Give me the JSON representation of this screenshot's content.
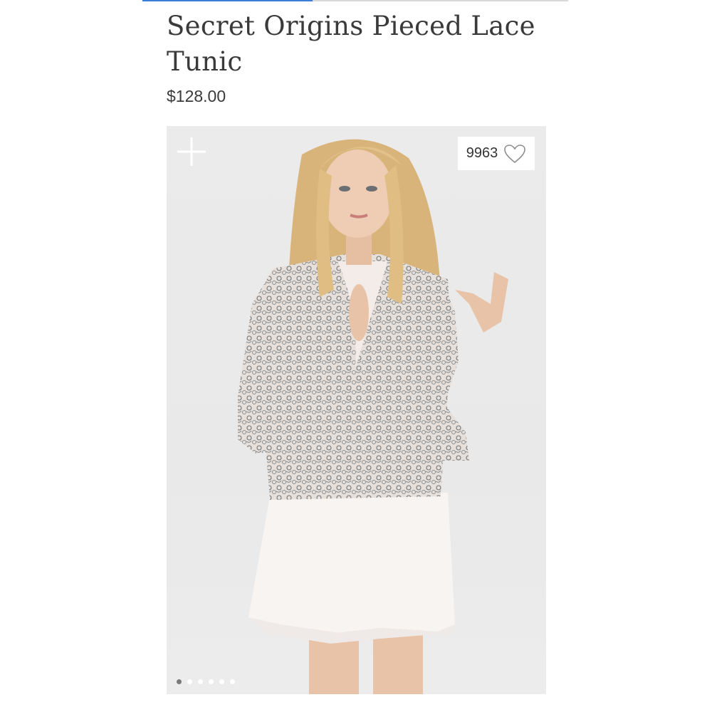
{
  "product": {
    "title": "Secret Origins Pieced Lace Tunic",
    "price": "$128.00"
  },
  "gallery": {
    "progress_fraction": 0.4,
    "like_count": "9963",
    "icons": [
      "plus-icon",
      "heart-icon"
    ],
    "slide_count": 6,
    "active_slide": 0
  },
  "colors": {
    "progress_fill": "#3d7bd9",
    "progress_track": "#d8d8d8",
    "text": "#3a3a3a",
    "image_bg": "#ebebeb"
  }
}
